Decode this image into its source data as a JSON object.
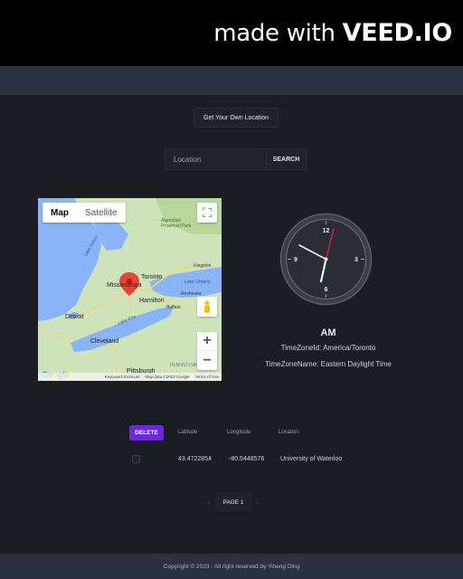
{
  "watermark": {
    "prefix": "made with ",
    "brand": "VEED.IO"
  },
  "get_location_button": "Get Your Own Location",
  "search": {
    "placeholder": "Location",
    "button_label": "SEARCH"
  },
  "map": {
    "type_controls": [
      "Map",
      "Satellite"
    ],
    "labels": {
      "toronto": "Toronto",
      "mississauga": "Mississauga",
      "hamilton": "Hamilton",
      "kingston": "Kingston",
      "rochester": "Rochester",
      "buffalo": "Buffalo",
      "detroit": "Detroit",
      "cleveland": "Cleveland",
      "pittsburgh": "Pittsburgh",
      "pennsylvania": "PENNSYLVANIA",
      "algonquin": "Algonquin Provincial Park",
      "lake_huron": "Lake Huron",
      "lake_erie": "Lake Erie",
      "lake_ontario": "Lake Ontario"
    },
    "google_logo": "Google",
    "footer": [
      "Keyboard shortcuts",
      "Map data ©2023 Google",
      "Terms of Use"
    ]
  },
  "clock": {
    "numerals": [
      "12",
      "3",
      "6",
      "9"
    ],
    "period": "AM"
  },
  "timezone": {
    "id_line": "TimeZoneId: America/Toronto",
    "name_line": "TimeZoneName: Eastern Daylight Time"
  },
  "table": {
    "delete_label": "DELETE",
    "headers": [
      "Latitude",
      "Longitude",
      "Location"
    ],
    "rows": [
      {
        "latitude": "43.4722854",
        "longitude": "-80.5448576",
        "location": "University of Waterloo"
      }
    ]
  },
  "pagination": {
    "prev": "‹",
    "page_label": "PAGE 1",
    "next": "›"
  },
  "footer": {
    "copyright": "Copyright © 2023 - All right reserved by Yiheng Ding"
  },
  "colors": {
    "accent": "#6d28d9",
    "background": "#1a1d22",
    "navbar": "#2b3340",
    "clock_second_hand": "#e11d48"
  }
}
